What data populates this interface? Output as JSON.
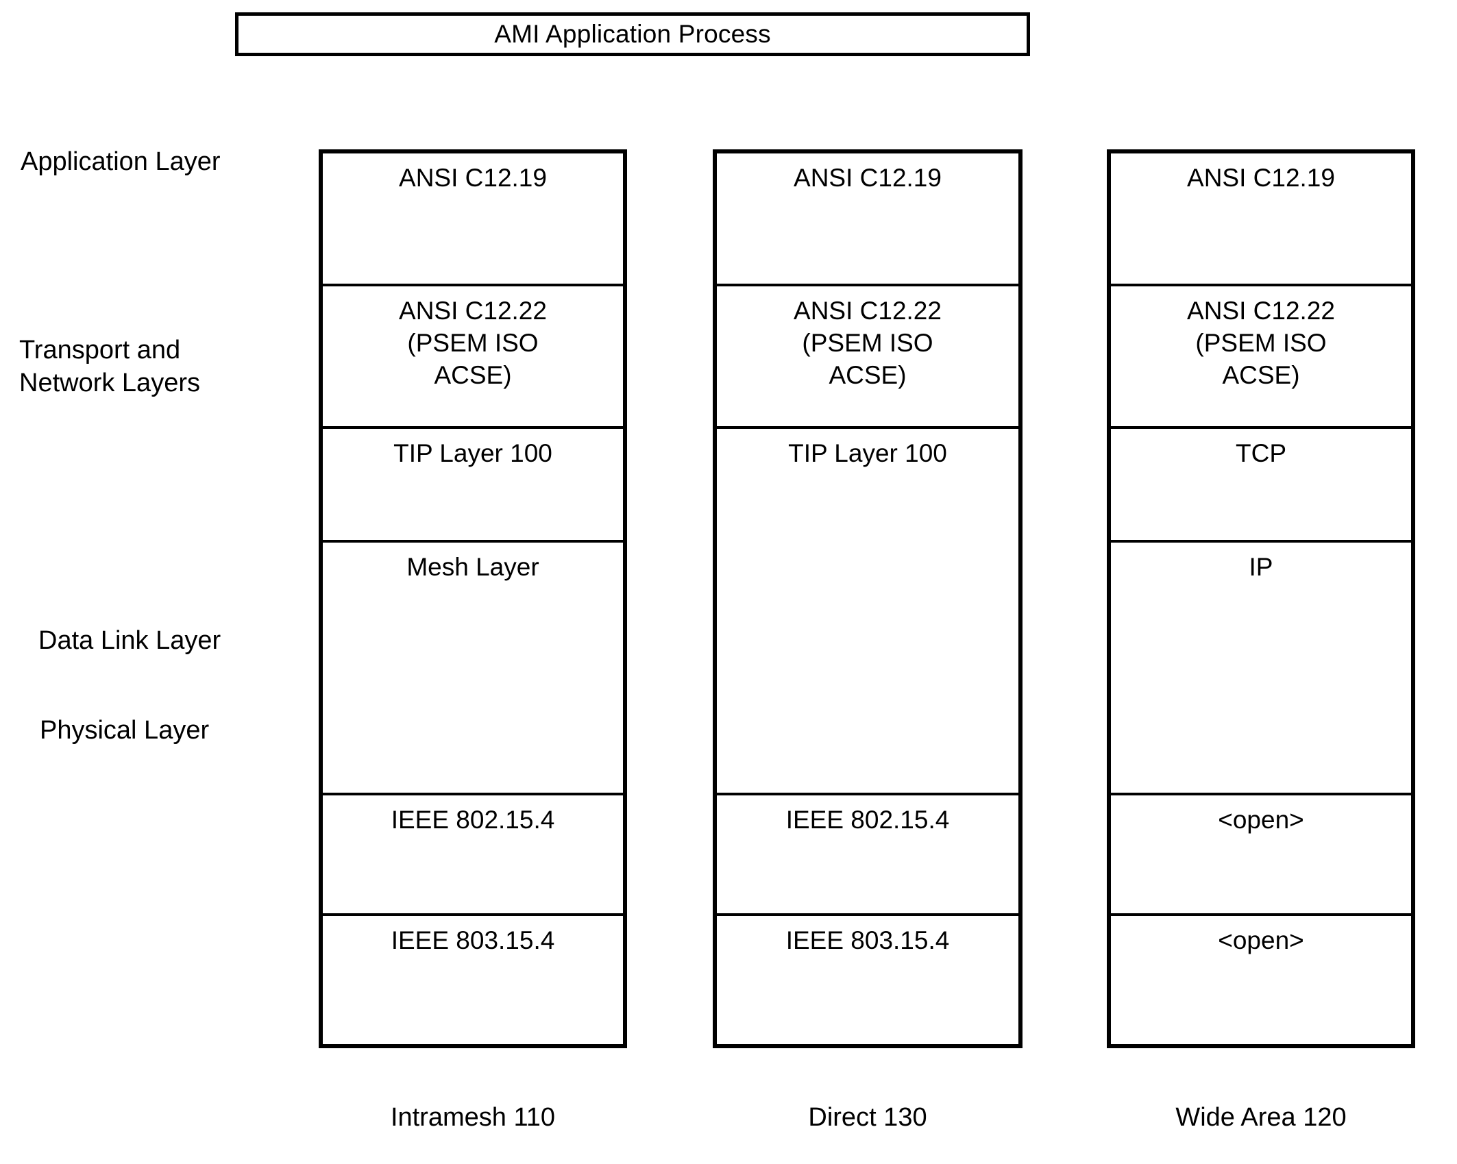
{
  "figure": {
    "kind": "protocol-stack-diagram",
    "process_box": {
      "label": "AMI Application Process"
    },
    "layer_captions": [
      {
        "id": "application",
        "label": "Application Layer"
      },
      {
        "id": "transport",
        "label": "Transport and\nNetwork Layers"
      },
      {
        "id": "datalink",
        "label": "Data Link Layer"
      },
      {
        "id": "physical",
        "label": "Physical Layer"
      }
    ],
    "stacks": [
      {
        "id": "intramesh",
        "caption": "Intramesh 110",
        "cells": [
          {
            "label": "ANSI C12.19",
            "height_pct": 14.9
          },
          {
            "label": "ANSI C12.22\n(PSEM ISO\nACSE)",
            "height_pct": 16.0
          },
          {
            "label": "TIP Layer 100",
            "height_pct": 12.8
          },
          {
            "label": "Mesh Layer",
            "height_pct": 28.4
          },
          {
            "label": "IEEE 802.15.4",
            "height_pct": 13.5
          },
          {
            "label": "IEEE 803.15.4",
            "height_pct": 14.4
          }
        ]
      },
      {
        "id": "direct",
        "caption": "Direct 130",
        "cells": [
          {
            "label": "ANSI C12.19",
            "height_pct": 14.9
          },
          {
            "label": "ANSI C12.22\n(PSEM ISO\nACSE)",
            "height_pct": 16.0
          },
          {
            "label": "TIP Layer 100",
            "height_pct": 41.2
          },
          {
            "label": "IEEE 802.15.4",
            "height_pct": 13.5
          },
          {
            "label": "IEEE 803.15.4",
            "height_pct": 14.4
          }
        ]
      },
      {
        "id": "widearea",
        "caption": "Wide Area 120",
        "cells": [
          {
            "label": "ANSI C12.19",
            "height_pct": 14.9
          },
          {
            "label": "ANSI C12.22\n(PSEM ISO\nACSE)",
            "height_pct": 16.0
          },
          {
            "label": "TCP",
            "height_pct": 12.8
          },
          {
            "label": "IP",
            "height_pct": 28.4
          },
          {
            "label": "<open>",
            "height_pct": 13.5
          },
          {
            "label": "<open>",
            "height_pct": 14.4
          }
        ]
      }
    ],
    "colors": {
      "line": "#000000",
      "background": "#ffffff",
      "text": "#000000"
    }
  }
}
